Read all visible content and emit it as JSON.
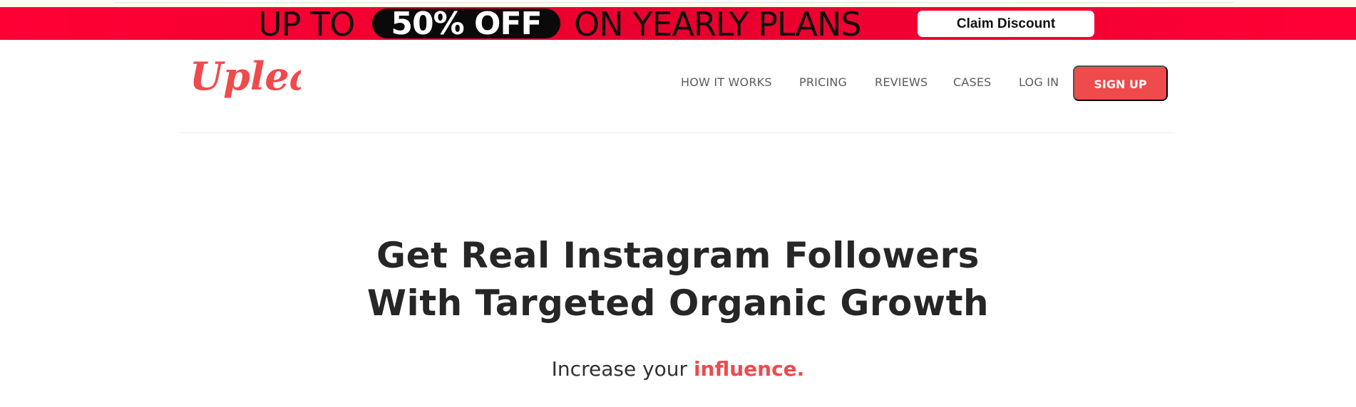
{
  "promo": {
    "prefix": "UP TO",
    "highlight": "50% OFF",
    "suffix": "ON YEARLY PLANS",
    "button_label": "Claim Discount"
  },
  "header": {
    "logo_text": "Upleap",
    "nav": [
      "HOW IT WORKS",
      "PRICING",
      "REVIEWS",
      "CASES",
      "LOG IN"
    ],
    "signup_label": "SIGN UP"
  },
  "hero": {
    "title_line1": "Get Real Instagram Followers",
    "title_line2": "With Targeted Organic Growth",
    "subtitle_prefix": "Increase your",
    "subtitle_accent": "influence."
  },
  "colors": {
    "promo_red": "#ff0035",
    "brand_coral": "#ef4a4c",
    "heading_dark": "#262626"
  }
}
